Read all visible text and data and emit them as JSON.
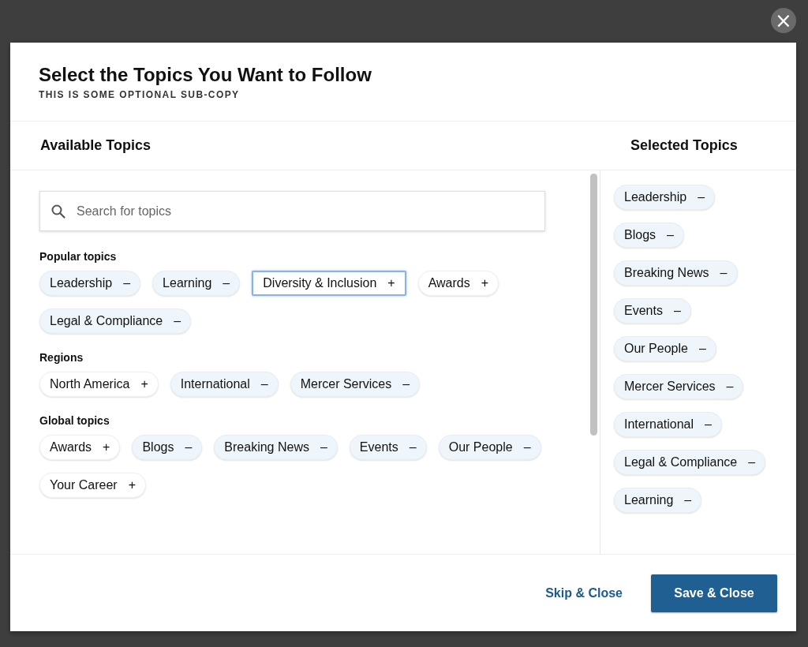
{
  "close_button": {
    "label": "×"
  },
  "dialog": {
    "title": "Select the Topics You Want to Follow",
    "subtitle": "THIS IS SOME OPTIONAL SUB-COPY"
  },
  "available": {
    "heading": "Available Topics",
    "search": {
      "placeholder": "Search for topics"
    },
    "groups": [
      {
        "label": "Popular topics",
        "chips": [
          {
            "label": "Leadership",
            "sign": "–",
            "selected": true,
            "focused": false
          },
          {
            "label": "Learning",
            "sign": "–",
            "selected": true,
            "focused": false
          },
          {
            "label": "Diversity & Inclusion",
            "sign": "+",
            "selected": false,
            "focused": true
          },
          {
            "label": "Awards",
            "sign": "+",
            "selected": false,
            "focused": false
          },
          {
            "label": "Legal & Compliance",
            "sign": "–",
            "selected": true,
            "focused": false
          }
        ]
      },
      {
        "label": "Regions",
        "chips": [
          {
            "label": "North America",
            "sign": "+",
            "selected": false,
            "focused": false
          },
          {
            "label": "International",
            "sign": "–",
            "selected": true,
            "focused": false
          },
          {
            "label": "Mercer Services",
            "sign": "–",
            "selected": true,
            "focused": false
          }
        ]
      },
      {
        "label": "Global topics",
        "chips": [
          {
            "label": "Awards",
            "sign": "+",
            "selected": false,
            "focused": false
          },
          {
            "label": "Blogs",
            "sign": "–",
            "selected": true,
            "focused": false
          },
          {
            "label": "Breaking News",
            "sign": "–",
            "selected": true,
            "focused": false
          },
          {
            "label": "Events",
            "sign": "–",
            "selected": true,
            "focused": false
          },
          {
            "label": "Our People",
            "sign": "–",
            "selected": true,
            "focused": false
          },
          {
            "label": "Your Career",
            "sign": "+",
            "selected": false,
            "focused": false
          }
        ]
      }
    ]
  },
  "selected_topics": {
    "heading": "Selected Topics",
    "chips": [
      {
        "label": "Leadership",
        "sign": "–"
      },
      {
        "label": "Blogs",
        "sign": "–"
      },
      {
        "label": "Breaking News",
        "sign": "–"
      },
      {
        "label": "Events",
        "sign": "–"
      },
      {
        "label": "Our People",
        "sign": "–"
      },
      {
        "label": "Mercer Services",
        "sign": "–"
      },
      {
        "label": "International",
        "sign": "–"
      },
      {
        "label": "Legal & Compliance",
        "sign": "–"
      },
      {
        "label": "Learning",
        "sign": "–"
      }
    ]
  },
  "footer": {
    "buttons": [
      {
        "label": "Skip & Close",
        "kind": "link"
      },
      {
        "label": "Save & Close",
        "kind": "primary"
      }
    ]
  }
}
